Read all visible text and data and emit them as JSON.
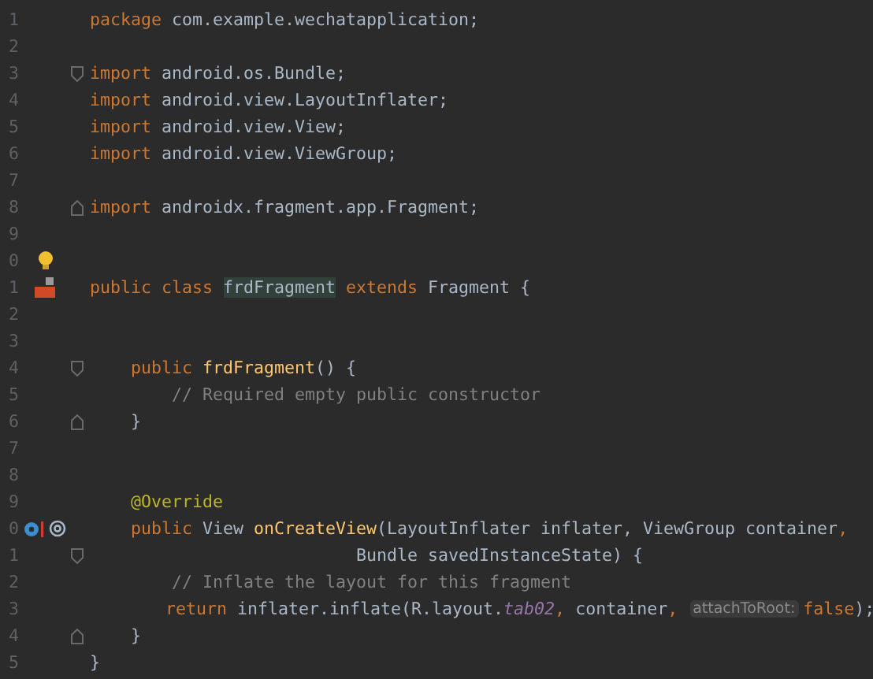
{
  "lines": [
    {
      "number": "1",
      "tokens": [
        {
          "kind": "keyword",
          "text": "package "
        },
        {
          "kind": "plain",
          "text": "com.example.wechatapplication;"
        }
      ]
    },
    {
      "number": "2"
    },
    {
      "number": "3",
      "fold_marker": {
        "kind": "start"
      },
      "tokens": [
        {
          "kind": "keyword",
          "text": "import "
        },
        {
          "kind": "plain",
          "text": "android.os.Bundle;"
        }
      ]
    },
    {
      "number": "4",
      "tokens": [
        {
          "kind": "keyword",
          "text": "import "
        },
        {
          "kind": "plain",
          "text": "android.view.LayoutInflater;"
        }
      ]
    },
    {
      "number": "5",
      "tokens": [
        {
          "kind": "keyword",
          "text": "import "
        },
        {
          "kind": "plain",
          "text": "android.view.View;"
        }
      ]
    },
    {
      "number": "6",
      "tokens": [
        {
          "kind": "keyword",
          "text": "import "
        },
        {
          "kind": "plain",
          "text": "android.view.ViewGroup;"
        }
      ]
    },
    {
      "number": "7"
    },
    {
      "number": "8",
      "fold_marker": {
        "kind": "end"
      },
      "tokens": [
        {
          "kind": "keyword",
          "text": "import "
        },
        {
          "kind": "plain",
          "text": "androidx.fragment.app.Fragment;"
        }
      ]
    },
    {
      "number": "9"
    },
    {
      "number": "0",
      "gutter_icon": {
        "kind": "bulb"
      }
    },
    {
      "number": "1",
      "gutter_icon": {
        "kind": "class"
      },
      "tokens": [
        {
          "kind": "keyword",
          "text": "public class "
        },
        {
          "kind": "highlighted",
          "text": "frdFragment"
        },
        {
          "kind": "keyword",
          "text": " extends "
        },
        {
          "kind": "plain",
          "text": "Fragment {"
        }
      ]
    },
    {
      "number": "2"
    },
    {
      "number": "3"
    },
    {
      "number": "4",
      "fold_marker": {
        "kind": "start"
      },
      "tokens": [
        {
          "kind": "keyword",
          "text": "    public "
        },
        {
          "kind": "method",
          "text": "frdFragment"
        },
        {
          "kind": "plain",
          "text": "() {"
        }
      ]
    },
    {
      "number": "5",
      "tokens": [
        {
          "kind": "comment",
          "text": "        // Required empty public constructor"
        }
      ]
    },
    {
      "number": "6",
      "fold_marker": {
        "kind": "end"
      },
      "tokens": [
        {
          "kind": "plain",
          "text": "    }"
        }
      ]
    },
    {
      "number": "7"
    },
    {
      "number": "8"
    },
    {
      "number": "9",
      "tokens": [
        {
          "kind": "annotation",
          "text": "    @Override"
        }
      ]
    },
    {
      "number": "0",
      "gutter_icon": {
        "kind": "override"
      },
      "tokens": [
        {
          "kind": "keyword",
          "text": "    public "
        },
        {
          "kind": "plain",
          "text": "View "
        },
        {
          "kind": "method",
          "text": "onCreateView"
        },
        {
          "kind": "plain",
          "text": "(LayoutInflater inflater, ViewGroup container"
        },
        {
          "kind": "keyword",
          "text": ","
        }
      ]
    },
    {
      "number": "1",
      "fold_marker": {
        "kind": "start"
      },
      "tokens": [
        {
          "kind": "plain",
          "text": "                          Bundle savedInstanceState) {"
        }
      ]
    },
    {
      "number": "2",
      "tokens": [
        {
          "kind": "comment",
          "text": "        // Inflate the layout for this fragment"
        }
      ]
    },
    {
      "number": "3",
      "tokens": [
        {
          "kind": "keyword",
          "text": "        return "
        },
        {
          "kind": "plain",
          "text": "inflater.inflate(R.layout."
        },
        {
          "kind": "field",
          "text": "tab02"
        },
        {
          "kind": "keyword",
          "text": ", "
        },
        {
          "kind": "plain",
          "text": "container"
        },
        {
          "kind": "keyword",
          "text": ", "
        },
        {
          "kind": "hint",
          "text": "attachToRoot:"
        },
        {
          "kind": "keyword",
          "text": "false"
        },
        {
          "kind": "plain",
          "text": ");"
        }
      ]
    },
    {
      "number": "4",
      "fold_marker": {
        "kind": "end"
      },
      "tokens": [
        {
          "kind": "plain",
          "text": "    }"
        }
      ]
    },
    {
      "number": "5",
      "tokens": [
        {
          "kind": "plain",
          "text": "}"
        }
      ]
    }
  ]
}
